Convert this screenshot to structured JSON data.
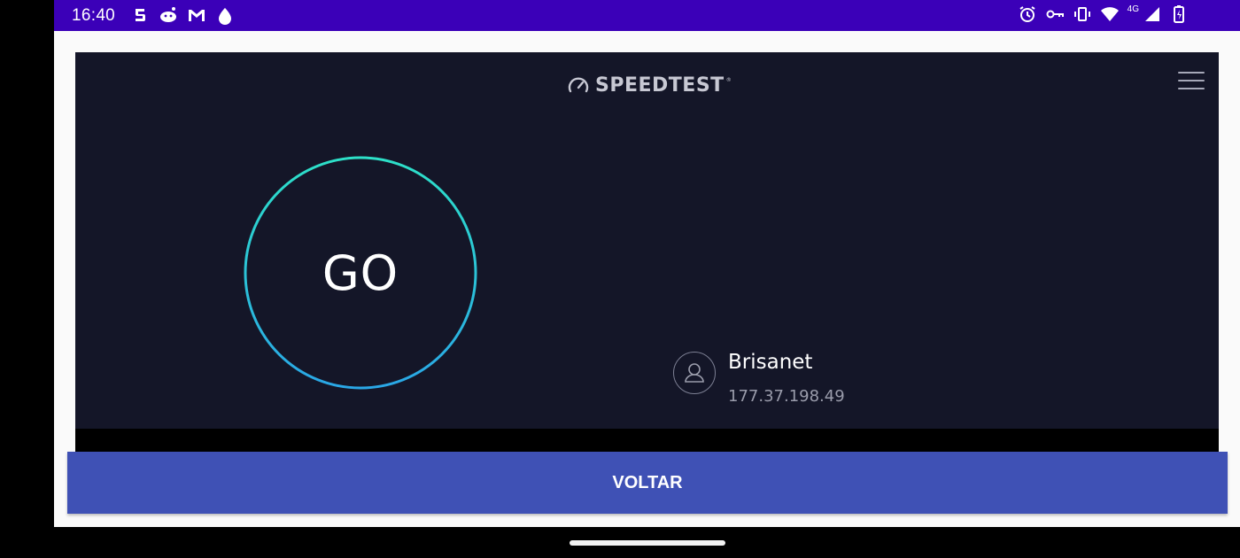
{
  "status_bar": {
    "time": "16:40",
    "network_tag": "4G",
    "left_icons": [
      "notification-s-icon",
      "reddit-icon",
      "gmail-icon",
      "app-drop-icon"
    ],
    "right_icons": [
      "alarm-icon",
      "vpn-key-icon",
      "vibrate-icon",
      "wifi-icon",
      "cell-signal-icon",
      "battery-charging-icon"
    ],
    "color": "#3b00b8"
  },
  "speedtest": {
    "logo_text": "SPEEDTEST",
    "trademark": "®",
    "go_label": "GO",
    "ring_colors": [
      "#2de0c8",
      "#2aa7e6"
    ],
    "background": "#141628",
    "isp": {
      "name": "Brisanet",
      "ip": "177.37.198.49"
    }
  },
  "back_button": {
    "label": "VOLTAR",
    "color": "#3f51b5"
  }
}
